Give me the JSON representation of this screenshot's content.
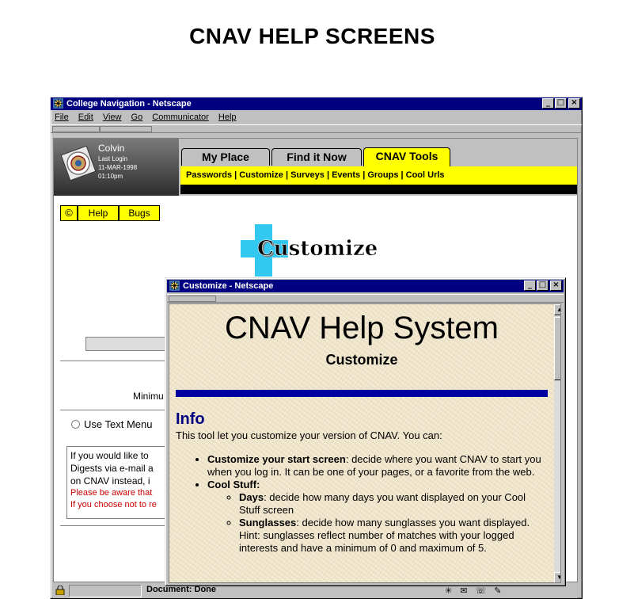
{
  "page": {
    "heading": "CNAV HELP SCREENS"
  },
  "main_window": {
    "title": "College Navigation - Netscape",
    "menu": [
      "File",
      "Edit",
      "View",
      "Go",
      "Communicator",
      "Help"
    ],
    "user": {
      "name": "Colvin",
      "last_login_label": "Last Login",
      "date": "11-MAR-1998",
      "time": "01:10pm"
    },
    "tabs": [
      {
        "label": "My Place",
        "active": false
      },
      {
        "label": "Find it Now",
        "active": false
      },
      {
        "label": "CNAV Tools",
        "active": true
      }
    ],
    "subnav": "Passwords | Customize | Surveys | Events | Groups | Cool Urls",
    "help_buttons": {
      "copyright": "©",
      "help": "Help",
      "bugs": "Bugs"
    },
    "customize_logo_text": "Customize",
    "minimum_label": "Minimu",
    "text_menu_label": "Use Text Menu",
    "info_box": {
      "line1": "If you would like to",
      "line2": "Digests via e-mail a",
      "line3": "on CNAV instead, i",
      "red1": "Please be aware that",
      "red2": "If you choose not to re"
    },
    "status": "Document: Done"
  },
  "popup_window": {
    "title": "Customize - Netscape",
    "help_title": "CNAV Help System",
    "help_subtitle": "Customize",
    "info_heading": "Info",
    "intro": "This tool let you customize your version of CNAV. You can:",
    "items": [
      {
        "term": "Customize your start screen",
        "text": ": decide where you want CNAV to start you when you log in. It can be one of your pages, or a favorite from the web."
      },
      {
        "term": "Cool Stuff:",
        "text": ""
      }
    ],
    "subitems": [
      {
        "term": "Days",
        "text": ": decide how many days you want displayed on your Cool Stuff screen"
      },
      {
        "term": "Sunglasses",
        "text": ": decide how many sunglasses you want displayed. Hint: sunglasses reflect number of matches with your logged interests and have a minimum of 0 and maximum of 5."
      }
    ]
  },
  "colors": {
    "titlebar": "#000080",
    "highlight": "#ffff00",
    "rule": "#0000a0",
    "alert": "#cc0000"
  }
}
